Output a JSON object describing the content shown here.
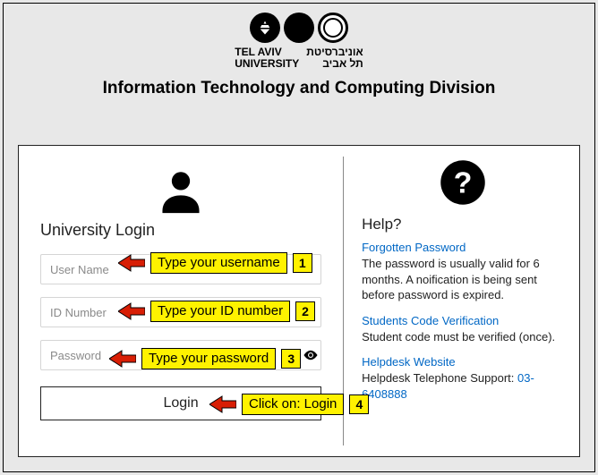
{
  "university": {
    "name_en_line1": "TEL AVIV",
    "name_en_line2": "UNIVERSITY",
    "name_he_line1": "אוניברסיטת",
    "name_he_line2": "תל אביב"
  },
  "division_title": "Information Technology and Computing Division",
  "login": {
    "title": "University Login",
    "username_placeholder": "User Name",
    "id_placeholder": "ID Number",
    "password_placeholder": "Password",
    "button_label": "Login"
  },
  "help": {
    "title": "Help?",
    "forgotten_link": "Forgotten Password",
    "forgotten_text": "The password is usually valid for 6 months. A noification is being sent before password is expired.",
    "students_link": "Students Code Verification",
    "students_text": "Student code must be verified (once).",
    "helpdesk_link": "Helpdesk Website",
    "helpdesk_phone_label": "Helpdesk Telephone Support: ",
    "helpdesk_phone": "03-6408888"
  },
  "annotations": {
    "a1": "Type your username",
    "a2": "Type your ID number",
    "a3": "Type your password",
    "a4": "Click on: Login",
    "n1": "1",
    "n2": "2",
    "n3": "3",
    "n4": "4"
  }
}
